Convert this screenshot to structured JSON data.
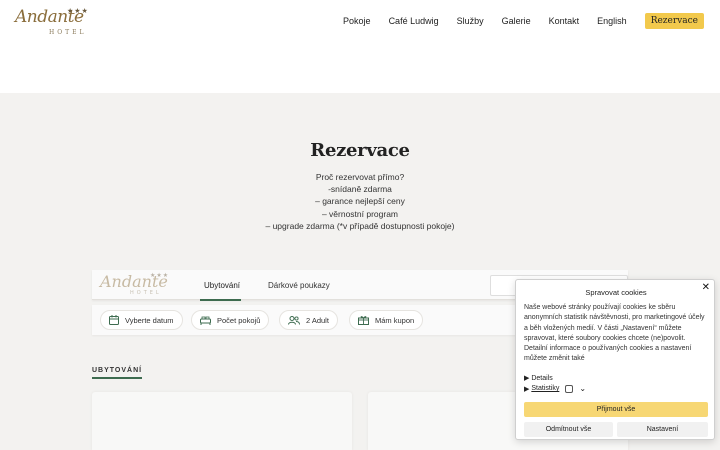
{
  "header": {
    "logo": {
      "script": "Andante",
      "sub": "HOTEL",
      "stars": "★★★"
    },
    "nav": [
      "Pokoje",
      "Café Ludwig",
      "Služby",
      "Galerie",
      "Kontakt",
      "English"
    ],
    "cta": "Rezervace"
  },
  "reservation": {
    "title": "Rezervace",
    "why_lines": [
      "Proč rezervovat přímo?",
      "-snídaně zdarma",
      "– garance nejlepší ceny",
      "– věrnostní program",
      "– upgrade zdarma  (*v případě dostupnosti pokoje)"
    ]
  },
  "widget": {
    "logo": {
      "script": "Andante",
      "sub": "HOTEL",
      "stars": "★★★"
    },
    "tabs": [
      "Ubytování",
      "Dárkové poukazy"
    ],
    "filters": [
      "Vyberte datum",
      "Počet pokojů",
      "2 Adult",
      "Mám kupon"
    ]
  },
  "section_label": "UBYTOVÁNÍ",
  "cookie": {
    "title": "Spravovat cookies",
    "body": "Naše webové stránky používají cookies ke sběru anonymních statistik návštěvnosti, pro marketingové účely a běh vložených medií. V části „Nastavení“ můžete spravovat, které soubory cookies chcete (ne)povolit. Detailní informace o používaných cookies a nastavení můžete změnit také",
    "details": "Details",
    "statistics": "Statistiky",
    "accept": "Přijmout vše",
    "deny": "Odmítnout vše",
    "settings": "Nastavení",
    "close": "✕"
  },
  "colors": {
    "accent": "#f2c94c",
    "green": "#3d6b4f",
    "gold": "#8a6d3b",
    "section_bg": "#f3f2f0"
  }
}
